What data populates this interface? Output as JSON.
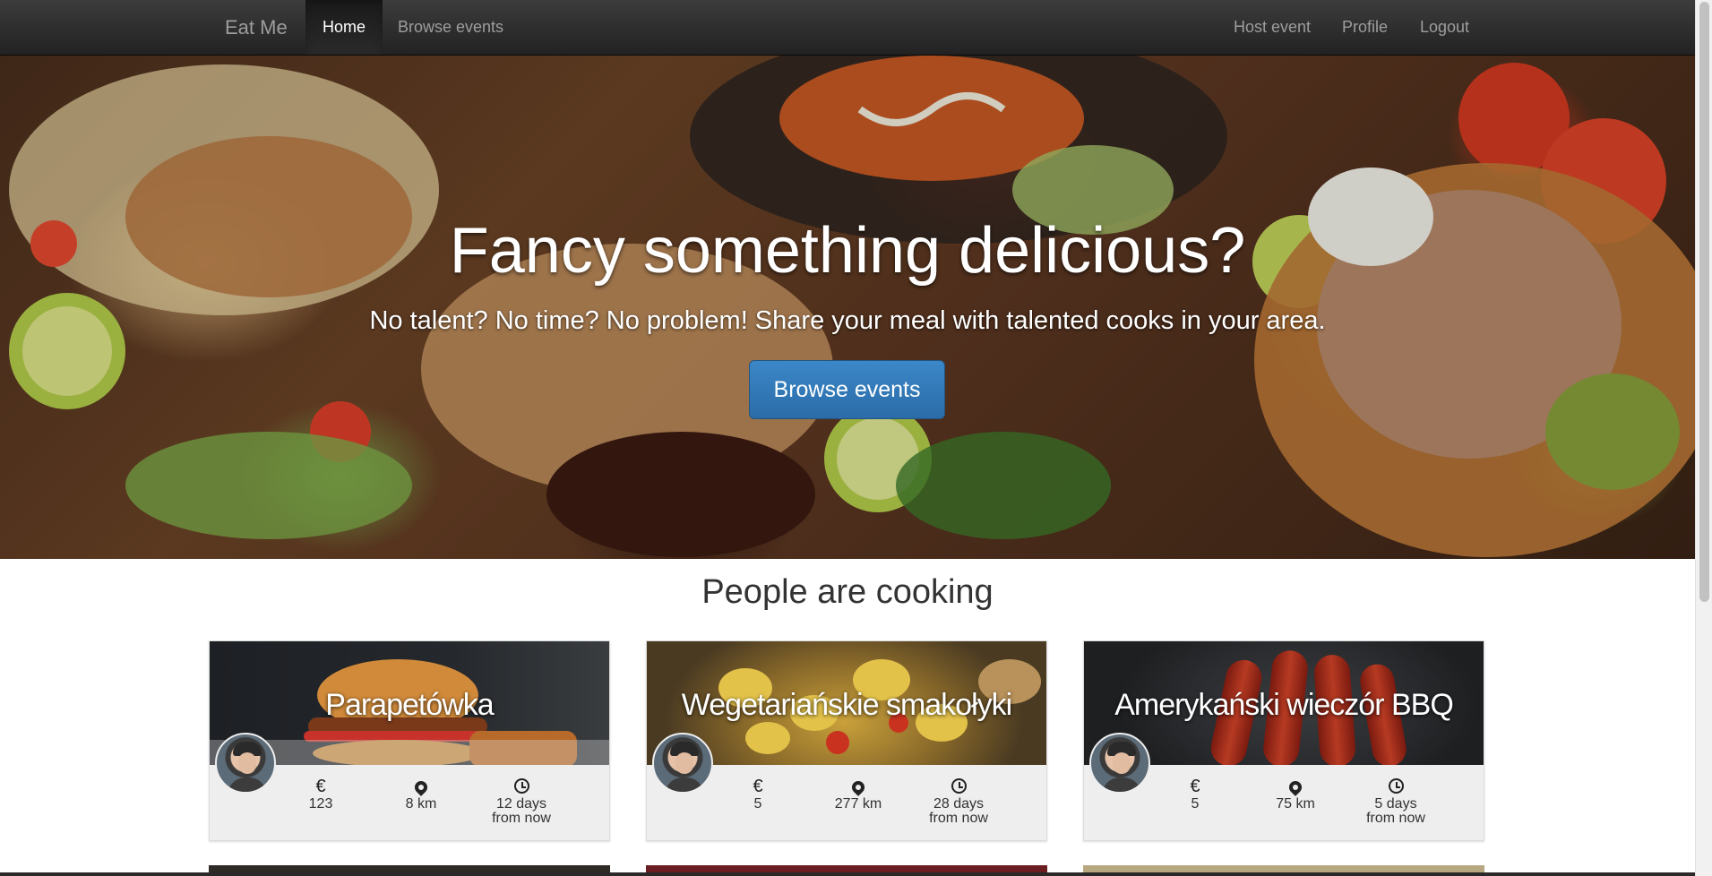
{
  "navbar": {
    "brand": "Eat Me",
    "left_items": [
      {
        "label": "Home",
        "active": true
      },
      {
        "label": "Browse events",
        "active": false
      }
    ],
    "right_items": [
      {
        "label": "Host event"
      },
      {
        "label": "Profile"
      },
      {
        "label": "Logout"
      }
    ]
  },
  "hero": {
    "title": "Fancy something delicious?",
    "subtitle": "No talent? No time? No problem! Share your meal with talented cooks in your area.",
    "button_label": "Browse events"
  },
  "section": {
    "title": "People are cooking"
  },
  "icons": {
    "price": "€",
    "distance": "map-marker-icon",
    "time": "alarm-clock-icon"
  },
  "events": [
    {
      "title": "Parapetówka",
      "price": "123",
      "distance": "8 km",
      "time_line1": "12 days",
      "time_line2": "from now"
    },
    {
      "title": "Wegetariańskie smakołyki",
      "price": "5",
      "distance": "277 km",
      "time_line1": "28 days",
      "time_line2": "from now"
    },
    {
      "title": "Amerykański wieczór BBQ",
      "price": "5",
      "distance": "75 km",
      "time_line1": "5 days",
      "time_line2": "from now"
    }
  ],
  "colors": {
    "navbar": "#222222",
    "primary_button": "#337ab7",
    "card_background": "#eeeeee"
  }
}
